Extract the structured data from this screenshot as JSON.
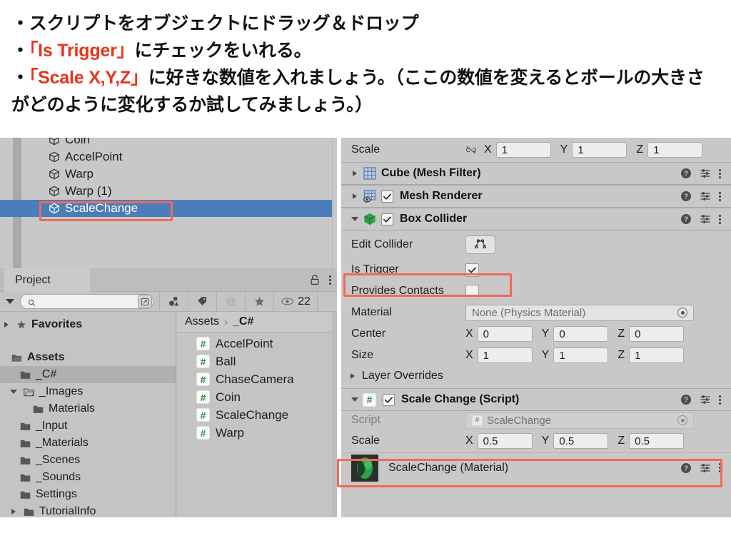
{
  "instructions": {
    "line1": "・スクリプトをオブジェクトにドラッグ＆ドロップ",
    "line2_bullet": "・",
    "line2_red": "「Is Trigger」",
    "line2_rest": "にチェックをいれる。",
    "line3_bullet": "・",
    "line3_red": "「Scale X,Y,Z」",
    "line3_rest": "に好きな数値を入れましょう。（ここの数値を変えるとボールの大きさがどのように変化するか試してみましょう。）",
    "accent_color": "#e8331c"
  },
  "hierarchy": {
    "items": [
      {
        "label": "Coin",
        "icon": "cube-icon",
        "selected": false
      },
      {
        "label": "AccelPoint",
        "icon": "cube-icon",
        "selected": false
      },
      {
        "label": "Warp",
        "icon": "cube-icon",
        "selected": false
      },
      {
        "label": "Warp (1)",
        "icon": "cube-icon",
        "selected": false
      },
      {
        "label": "ScaleChange",
        "icon": "cube-icon",
        "selected": true
      }
    ],
    "selection_color": "#4a7ebb",
    "highlight_color": "#f06a5a"
  },
  "project": {
    "tab_label": "Project",
    "search_placeholder": "",
    "visible_count": "22",
    "toolbar_icons": [
      "search-icon",
      "expand-search-icon",
      "asset-type-filter-icon",
      "label-filter-icon",
      "warning-filter-icon",
      "favorite-filter-icon",
      "visibility-icon"
    ],
    "tree": [
      {
        "label": "Favorites",
        "depth": 0,
        "bold": true,
        "icon": "star-icon",
        "twisty": "right",
        "selected": false
      },
      {
        "label": "",
        "depth": 0,
        "spacer": true
      },
      {
        "label": "Assets",
        "depth": 0,
        "bold": true,
        "icon": "folder-open-icon",
        "twisty": "none",
        "selected": false
      },
      {
        "label": "_C#",
        "depth": 1,
        "bold": false,
        "icon": "folder-icon",
        "twisty": "none",
        "selected": true
      },
      {
        "label": "_Images",
        "depth": 1,
        "bold": false,
        "icon": "folder-open-icon",
        "twisty": "down",
        "selected": false
      },
      {
        "label": "Materials",
        "depth": 2,
        "bold": false,
        "icon": "folder-icon",
        "twisty": "none",
        "selected": false
      },
      {
        "label": "_Input",
        "depth": 1,
        "bold": false,
        "icon": "folder-icon",
        "twisty": "none",
        "selected": false
      },
      {
        "label": "_Materials",
        "depth": 1,
        "bold": false,
        "icon": "folder-icon",
        "twisty": "none",
        "selected": false
      },
      {
        "label": "_Scenes",
        "depth": 1,
        "bold": false,
        "icon": "folder-icon",
        "twisty": "none",
        "selected": false
      },
      {
        "label": "_Sounds",
        "depth": 1,
        "bold": false,
        "icon": "folder-icon",
        "twisty": "none",
        "selected": false
      },
      {
        "label": "Settings",
        "depth": 1,
        "bold": false,
        "icon": "folder-icon",
        "twisty": "none",
        "selected": false
      },
      {
        "label": "TutorialInfo",
        "depth": 1,
        "bold": false,
        "icon": "folder-icon",
        "twisty": "right",
        "selected": false
      }
    ],
    "breadcrumb": {
      "root": "Assets",
      "separator": "›",
      "current": "_C#"
    },
    "assets": [
      {
        "label": "AccelPoint",
        "icon": "csharp-script-icon"
      },
      {
        "label": "Ball",
        "icon": "csharp-script-icon"
      },
      {
        "label": "ChaseCamera",
        "icon": "csharp-script-icon"
      },
      {
        "label": "Coin",
        "icon": "csharp-script-icon"
      },
      {
        "label": "ScaleChange",
        "icon": "csharp-script-icon"
      },
      {
        "label": "Warp",
        "icon": "csharp-script-icon"
      }
    ]
  },
  "inspector": {
    "transform_scale": {
      "label": "Scale",
      "link_icon": "broken-link-icon",
      "x_axis": "X",
      "x_value": "1",
      "y_axis": "Y",
      "y_value": "1",
      "z_axis": "Z",
      "z_value": "1"
    },
    "components": [
      {
        "name": "Cube (Mesh Filter)",
        "foldout": "right",
        "icon": "mesh-filter-icon",
        "has_checkbox": false,
        "checked": false,
        "actions": [
          "help-icon",
          "preset-icon",
          "kebab-icon"
        ]
      },
      {
        "name": "Mesh Renderer",
        "foldout": "right",
        "icon": "mesh-renderer-icon",
        "has_checkbox": true,
        "checked": true,
        "actions": [
          "help-icon",
          "preset-icon",
          "kebab-icon"
        ]
      },
      {
        "name": "Box Collider",
        "foldout": "down",
        "icon": "box-collider-icon",
        "has_checkbox": true,
        "checked": true,
        "actions": [
          "help-icon",
          "preset-icon",
          "kebab-icon"
        ]
      }
    ],
    "box_collider": {
      "edit_collider_label": "Edit Collider",
      "edit_collider_icon": "edit-collider-icon",
      "is_trigger_label": "Is Trigger",
      "is_trigger_checked": true,
      "provides_contacts_label": "Provides Contacts",
      "provides_contacts_checked": false,
      "material_label": "Material",
      "material_value": "None (Physics Material)",
      "center_label": "Center",
      "center": {
        "x_axis": "X",
        "x": "0",
        "y_axis": "Y",
        "y": "0",
        "z_axis": "Z",
        "z": "0"
      },
      "size_label": "Size",
      "size": {
        "x_axis": "X",
        "x": "1",
        "y_axis": "Y",
        "y": "1",
        "z_axis": "Z",
        "z": "1"
      },
      "layer_overrides_label": "Layer Overrides"
    },
    "script_component": {
      "name": "Scale Change (Script)",
      "foldout": "down",
      "icon": "csharp-script-icon",
      "checked": true,
      "script_label": "Script",
      "script_value": "ScaleChange",
      "scale_label": "Scale",
      "scale": {
        "x_axis": "X",
        "x": "0.5",
        "y_axis": "Y",
        "y": "0.5",
        "z_axis": "Z",
        "z": "0.5"
      }
    },
    "material_component": {
      "name": "ScaleChange (Material)",
      "icon": "material-sphere-icon",
      "actions": [
        "help-icon",
        "preset-icon",
        "kebab-icon"
      ]
    },
    "highlight_color": "#f06a5a"
  }
}
